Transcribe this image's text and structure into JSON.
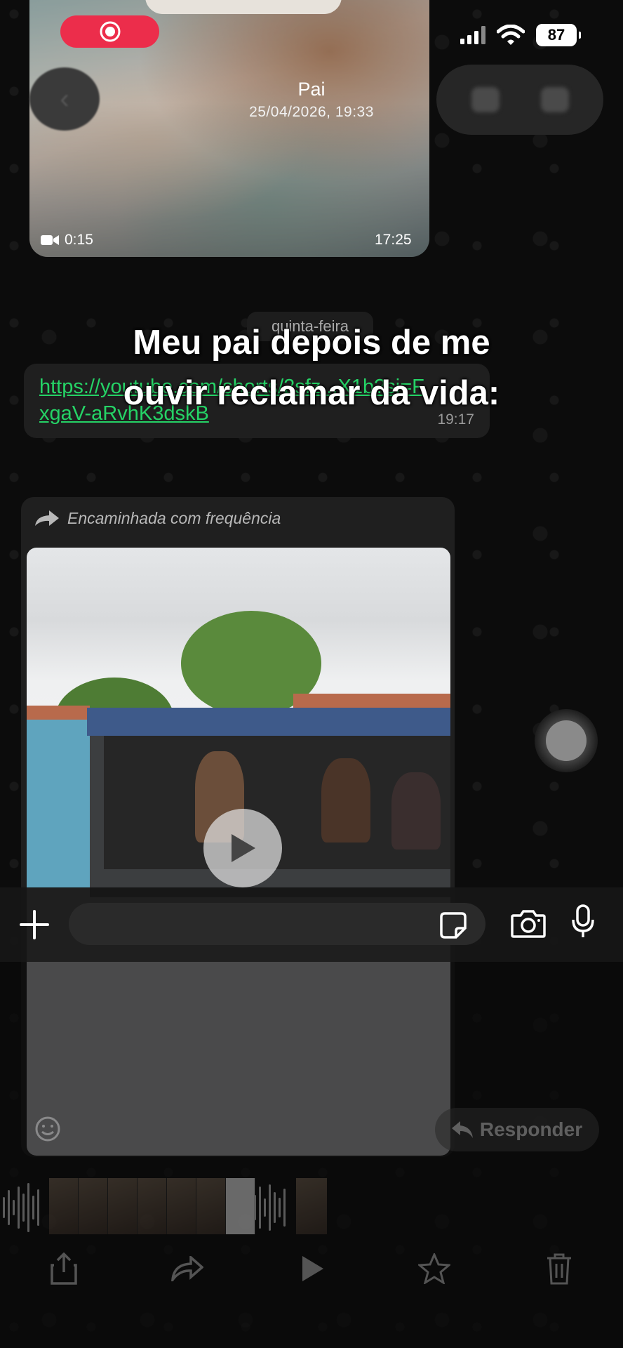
{
  "status_bar": {
    "battery": "87",
    "record_icon": "screen-record-icon",
    "signal_icon": "cellular-signal-icon",
    "wifi_icon": "wifi-icon"
  },
  "viewer": {
    "sender": "Pai",
    "datetime": "25/04/2026, 19:33",
    "video_duration": "0:15",
    "video_time": "17:25"
  },
  "chat": {
    "date_separator": "quinta-feira",
    "link_message": {
      "text": "https://youtube.com/shorts/2sfz...X1b?si=FxgaV-aRvhK3dskB",
      "time": "19:17"
    },
    "forwarded": {
      "label": "Encaminhada com frequência"
    }
  },
  "caption": {
    "line1": "Meu pai depois de me",
    "line2": "ouvir reclamar da vida:"
  },
  "composer": {
    "placeholder": ""
  },
  "bottom": {
    "reply_label": "Responder"
  },
  "colors": {
    "record_red": "#ec2d4b",
    "link_green": "#25d366",
    "bubble_bg": "#1f1f1f"
  }
}
